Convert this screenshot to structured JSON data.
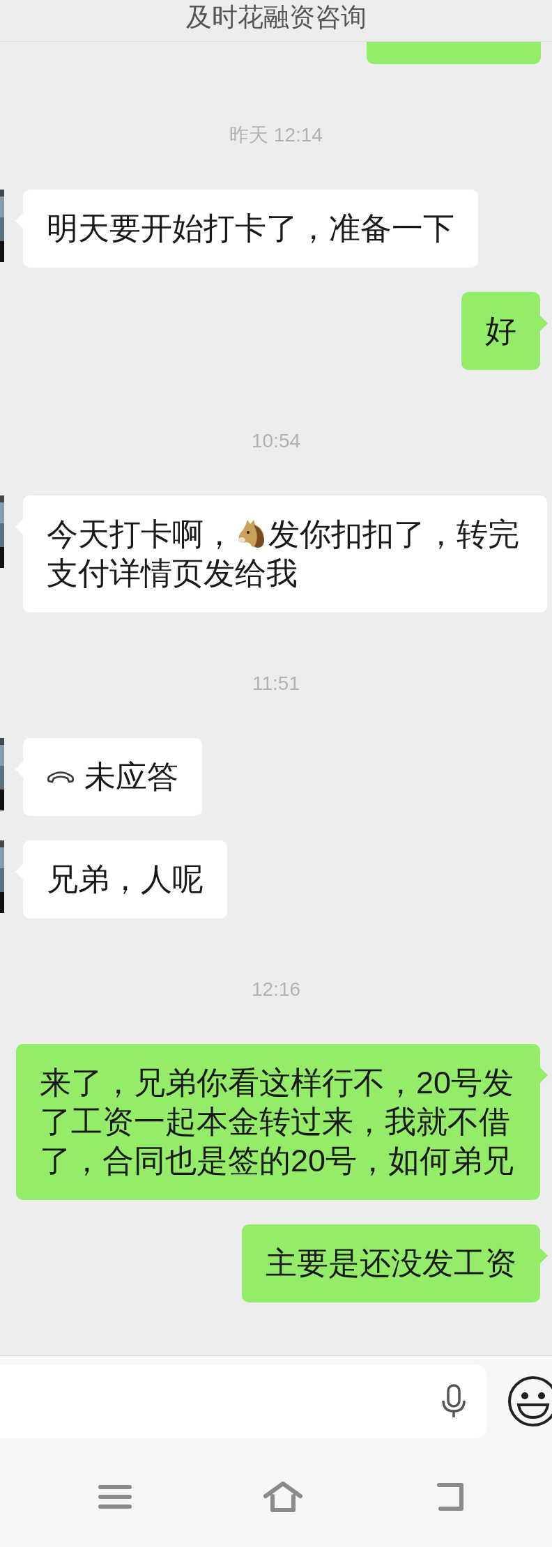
{
  "header": {
    "title": "及时花融资咨询"
  },
  "messages": [
    {
      "kind": "partial",
      "from_me": true
    },
    {
      "kind": "time",
      "text": "昨天 12:14"
    },
    {
      "kind": "text",
      "from_me": false,
      "parts": [
        "明天要开始打卡了，准备一下"
      ]
    },
    {
      "kind": "text",
      "from_me": true,
      "parts": [
        "好"
      ]
    },
    {
      "kind": "time",
      "text": "10:54"
    },
    {
      "kind": "text",
      "from_me": false,
      "parts": [
        "今天打卡啊，",
        {
          "kind": "emoji"
        },
        "发你扣扣了，转完",
        "支付详情页发给我"
      ]
    },
    {
      "kind": "time",
      "text": "11:51"
    },
    {
      "kind": "call",
      "from_me": false,
      "text": "未应答"
    },
    {
      "kind": "text",
      "from_me": false,
      "parts": [
        "兄弟，人呢"
      ]
    },
    {
      "kind": "time",
      "text": "12:16"
    },
    {
      "kind": "text",
      "from_me": true,
      "parts": [
        "来了，兄弟你看这样行不，20号发了工资一起本金转过来，我就不借了，合同也是签的20号，如何弟兄"
      ]
    },
    {
      "kind": "text",
      "from_me": true,
      "parts": [
        "主要是还没发工资"
      ]
    }
  ]
}
